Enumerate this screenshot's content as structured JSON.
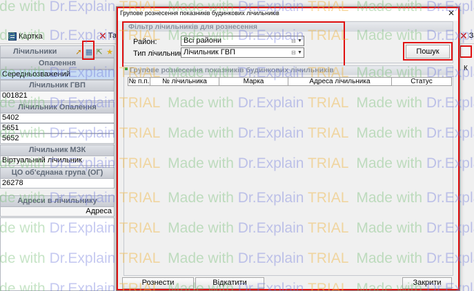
{
  "background": {
    "tabs": {
      "kartka": "Картка",
      "ta": "Та",
      "za": "За"
    },
    "left_panel": {
      "toolbar_title": "Лічильники",
      "section_opalennia": "Опалення",
      "value_seredniozvazheni": "Середньозважений",
      "section_gvp": "Лічильник ГВП",
      "value_gvp": "001821",
      "section_opalennia_meter": "Лічильник Опалення",
      "opalennia_values": [
        "5402",
        "5651",
        "5652"
      ],
      "section_mzk": "Лічильник МЗК",
      "value_mzk": "Віртуальний лічильник",
      "section_group": "ЦО об'єднана група (ОГ)",
      "value_group": "26278",
      "section_addresses": "Адреси в лічильнику",
      "value_addresses": "Адреса"
    },
    "right_strip": {
      "k_label": "К"
    }
  },
  "dialog": {
    "title": "Групове рознесення показників будинкових лічильників",
    "close_glyph": "✕",
    "filter": {
      "legend": "Фільтр лічильників для рознесення",
      "district_label": "Район:",
      "district_value": "Всі райони",
      "meter_type_label": "Тип лічильника:",
      "meter_type_value": "Лічильник ГВП",
      "search_button": "Пошук"
    },
    "results": {
      "legend": "Групове рознесення показників будинкових лічильників",
      "columns": [
        "№ п.п.",
        "№ лічильника",
        "Марка",
        "Адреса лічильника",
        "Статус"
      ]
    },
    "buttons": {
      "distribute": "Рознести лічильники",
      "rollback": "Відкатити лічильники",
      "close": "Закрити"
    }
  },
  "watermark": {
    "made": "Made",
    "with": "with",
    "dr": "Dr.Explain",
    "trial": "TRIAL"
  },
  "colors": {
    "highlight": "#e01010",
    "selection": "#c8dcf4"
  }
}
